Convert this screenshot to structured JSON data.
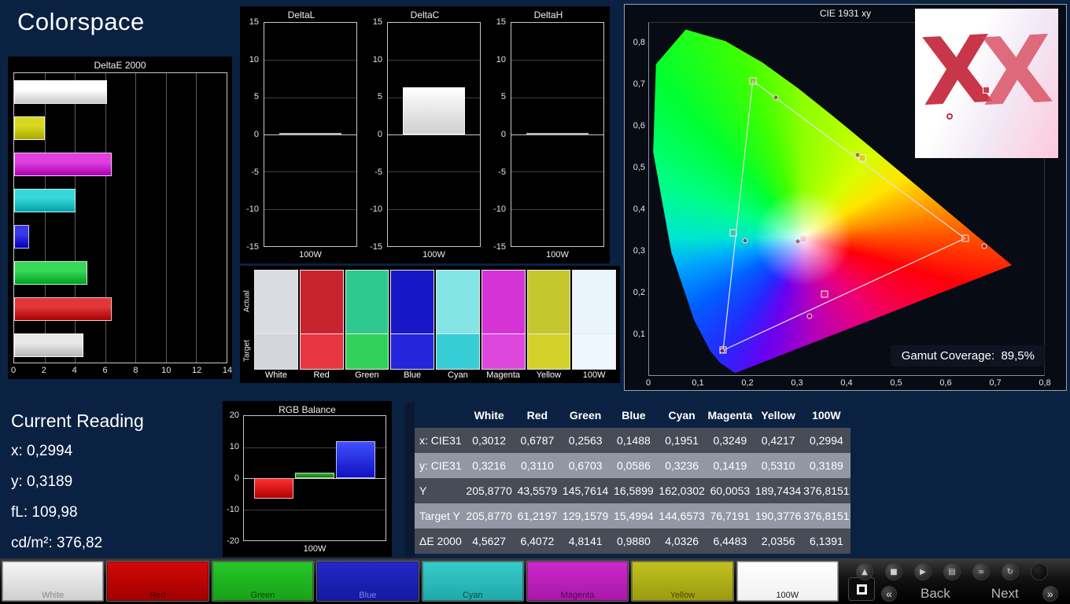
{
  "app": {
    "title": "Colorspace"
  },
  "theme": {
    "background": "#0b2142",
    "panel": "#000000",
    "table_dark": "#474c57",
    "table_light": "#9298a3"
  },
  "current_reading": {
    "title": "Current Reading",
    "lines": [
      "x: 0,2994",
      "y: 0,3189",
      "fL: 109,98",
      "cd/m²: 376,82"
    ]
  },
  "chart_data": [
    {
      "id": "deltae2000",
      "type": "bar",
      "orientation": "horizontal",
      "title": "DeltaE 2000",
      "xlim": [
        0,
        14
      ],
      "xticks": [
        "0",
        "2",
        "4",
        "6",
        "8",
        "10",
        "12",
        "14"
      ],
      "categories": [
        "100W",
        "Yellow",
        "Magenta",
        "Cyan",
        "Blue",
        "Green",
        "Red",
        "White"
      ],
      "values": [
        6.1391,
        2.0356,
        6.4483,
        4.0326,
        0.988,
        4.8141,
        6.4072,
        4.5627
      ],
      "bar_colors": [
        [
          "#ffffff",
          "#c8c8c8"
        ],
        [
          "#d8d820",
          "#a8a800"
        ],
        [
          "#e040e0",
          "#a800b0"
        ],
        [
          "#38d8d8",
          "#00a0a8"
        ],
        [
          "#3838e8",
          "#0000b0"
        ],
        [
          "#38d858",
          "#00a020"
        ],
        [
          "#e03838",
          "#a80000"
        ],
        [
          "#e8e8e8",
          "#b8b8b8"
        ]
      ]
    },
    {
      "id": "deltaL",
      "type": "bar",
      "title": "DeltaL",
      "ylim": [
        -15,
        15
      ],
      "yticks": [
        "15",
        "10",
        "5",
        "0",
        "-5",
        "-10",
        "-15"
      ],
      "categories": [
        "100W"
      ],
      "values": [
        0.05
      ],
      "bar_colors": [
        [
          "#ffffff",
          "#cfcfcf"
        ]
      ]
    },
    {
      "id": "deltaC",
      "type": "bar",
      "title": "DeltaC",
      "ylim": [
        -15,
        15
      ],
      "yticks": [
        "15",
        "10",
        "5",
        "0",
        "-5",
        "-10",
        "-15"
      ],
      "categories": [
        "100W"
      ],
      "values": [
        6.3
      ],
      "bar_colors": [
        [
          "#ffffff",
          "#cfcfcf"
        ]
      ]
    },
    {
      "id": "deltaH",
      "type": "bar",
      "title": "DeltaH",
      "ylim": [
        -15,
        15
      ],
      "yticks": [
        "15",
        "10",
        "5",
        "0",
        "-5",
        "-10",
        "-15"
      ],
      "categories": [
        "100W"
      ],
      "values": [
        0.05
      ],
      "bar_colors": [
        [
          "#ffffff",
          "#cfcfcf"
        ]
      ]
    },
    {
      "id": "rgb_balance",
      "type": "bar",
      "title": "RGB Balance",
      "ylim": [
        -20,
        20
      ],
      "yticks": [
        "20",
        "10",
        "0",
        "-10",
        "-20"
      ],
      "categories": [
        "100W"
      ],
      "series": [
        {
          "name": "Red",
          "value": -6.5,
          "colors": [
            "#ff3030",
            "#b00000"
          ]
        },
        {
          "name": "Green",
          "value": 1.8,
          "colors": [
            "#30b830",
            "#107010"
          ]
        },
        {
          "name": "Blue",
          "value": 12,
          "colors": [
            "#4050ff",
            "#1010c0"
          ]
        }
      ]
    },
    {
      "id": "cie1931",
      "type": "scatter",
      "title": "CIE 1931 xy",
      "xlim": [
        0,
        0.8
      ],
      "ylim": [
        0,
        0.85
      ],
      "xticks": [
        "0",
        "0,1",
        "0,2",
        "0,3",
        "0,4",
        "0,5",
        "0,6",
        "0,7",
        "0,8"
      ],
      "yticks": [
        "0,1",
        "0,2",
        "0,3",
        "0,4",
        "0,5",
        "0,6",
        "0,7",
        "0,8"
      ],
      "gamut_coverage_label": "Gamut Coverage:  89,5%",
      "logo_text": "XX",
      "target_triangle": [
        [
          0.21,
          0.71
        ],
        [
          0.64,
          0.33
        ],
        [
          0.15,
          0.06
        ]
      ],
      "target_points": [
        [
          0.3127,
          0.329
        ],
        [
          0.64,
          0.33
        ],
        [
          0.21,
          0.71
        ],
        [
          0.15,
          0.06
        ],
        [
          0.171,
          0.343
        ],
        [
          0.356,
          0.195
        ],
        [
          0.432,
          0.523
        ]
      ],
      "measured_points": [
        [
          0.3012,
          0.3216
        ],
        [
          0.6787,
          0.311
        ],
        [
          0.2563,
          0.6703
        ],
        [
          0.1488,
          0.0586
        ],
        [
          0.1951,
          0.3236
        ],
        [
          0.3249,
          0.1419
        ],
        [
          0.4217,
          0.531
        ]
      ],
      "spectral_locus": [
        [
          0.1741,
          0.005
        ],
        [
          0.144,
          0.0297
        ],
        [
          0.1241,
          0.0578
        ],
        [
          0.0913,
          0.1327
        ],
        [
          0.0454,
          0.295
        ],
        [
          0.0082,
          0.5384
        ],
        [
          0.0139,
          0.7502
        ],
        [
          0.0743,
          0.8338
        ],
        [
          0.1547,
          0.8059
        ],
        [
          0.2296,
          0.7543
        ],
        [
          0.3016,
          0.6923
        ],
        [
          0.3731,
          0.6245
        ],
        [
          0.4441,
          0.5547
        ],
        [
          0.5125,
          0.4866
        ],
        [
          0.5752,
          0.4242
        ],
        [
          0.627,
          0.3725
        ],
        [
          0.6915,
          0.3083
        ],
        [
          0.7347,
          0.2653
        ]
      ]
    }
  ],
  "swatch_panel": {
    "row_labels": [
      "Actual",
      "Target"
    ],
    "columns": [
      {
        "label": "White",
        "actual": "#d9dde3",
        "target": "#d2d5d9"
      },
      {
        "label": "Red",
        "actual": "#c82430",
        "target": "#e63640"
      },
      {
        "label": "Green",
        "actual": "#2ec98e",
        "target": "#31d15a"
      },
      {
        "label": "Blue",
        "actual": "#1717c8",
        "target": "#2525dc"
      },
      {
        "label": "Cyan",
        "actual": "#85e4e6",
        "target": "#37cdd6"
      },
      {
        "label": "Magenta",
        "actual": "#d633d6",
        "target": "#dd47dd"
      },
      {
        "label": "Yellow",
        "actual": "#c6c62e",
        "target": "#d2d22a"
      },
      {
        "label": "100W",
        "actual": "#eaf4fb",
        "target": "#eef7fd"
      }
    ]
  },
  "table": {
    "columns": [
      "",
      "White",
      "Red",
      "Green",
      "Blue",
      "Cyan",
      "Magenta",
      "Yellow",
      "100W"
    ],
    "rows": [
      {
        "label": "x: CIE31",
        "shade": "dark",
        "values": [
          "0,3012",
          "0,6787",
          "0,2563",
          "0,1488",
          "0,1951",
          "0,3249",
          "0,4217",
          "0,2994"
        ]
      },
      {
        "label": "y: CIE31",
        "shade": "light",
        "values": [
          "0,3216",
          "0,3110",
          "0,6703",
          "0,0586",
          "0,3236",
          "0,1419",
          "0,5310",
          "0,3189"
        ]
      },
      {
        "label": "Y",
        "shade": "dark",
        "values": [
          "205,8770",
          "43,5579",
          "145,7614",
          "16,5899",
          "162,0302",
          "60,0053",
          "189,7434",
          "376,8151"
        ]
      },
      {
        "label": "Target Y",
        "shade": "light",
        "values": [
          "205,8770",
          "61,2197",
          "129,1579",
          "15,4994",
          "144,6573",
          "76,7191",
          "190,3776",
          "376,8151"
        ]
      },
      {
        "label": "ΔE 2000",
        "shade": "dark",
        "values": [
          "4,5627",
          "6,4072",
          "4,8141",
          "0,9880",
          "4,0326",
          "6,4483",
          "2,0356",
          "6,1391"
        ]
      }
    ]
  },
  "bottom_bar": {
    "tiles": [
      {
        "label": "White",
        "colors": [
          "#f6f6f6",
          "#cfcfcf"
        ],
        "label_color": "#8a8a8a"
      },
      {
        "label": "Red",
        "colors": [
          "#d40808",
          "#a00000"
        ],
        "label_color": "#4a0808"
      },
      {
        "label": "Green",
        "colors": [
          "#28c828",
          "#18a018"
        ],
        "label_color": "#0a4a0a"
      },
      {
        "label": "Blue",
        "colors": [
          "#2428c8",
          "#1418a0"
        ],
        "label_color": "#7b84e8"
      },
      {
        "label": "Cyan",
        "colors": [
          "#38cccc",
          "#20a8a8"
        ],
        "label_color": "#0a4848"
      },
      {
        "label": "Magenta",
        "colors": [
          "#cc28cc",
          "#a818a8"
        ],
        "label_color": "#4a0a4a"
      },
      {
        "label": "Yellow",
        "colors": [
          "#c2c220",
          "#9a9a10"
        ],
        "label_color": "#4a4a08"
      },
      {
        "label": "100W",
        "colors": [
          "#ffffff",
          "#f0f0f0"
        ],
        "label_color": "#1a1a1a"
      }
    ],
    "controls": {
      "icon_buttons": [
        {
          "name": "chevron-up",
          "glyph": "▲"
        },
        {
          "name": "stop",
          "glyph": "■"
        },
        {
          "name": "play",
          "glyph": "▶"
        },
        {
          "name": "save",
          "glyph": "▤"
        },
        {
          "name": "loop",
          "glyph": "∞"
        },
        {
          "name": "refresh",
          "glyph": "↻"
        },
        {
          "name": "indicator",
          "glyph": ""
        }
      ],
      "back_glyph": "«",
      "back_label": "Back",
      "next_label": "Next",
      "next_glyph": "»"
    }
  }
}
